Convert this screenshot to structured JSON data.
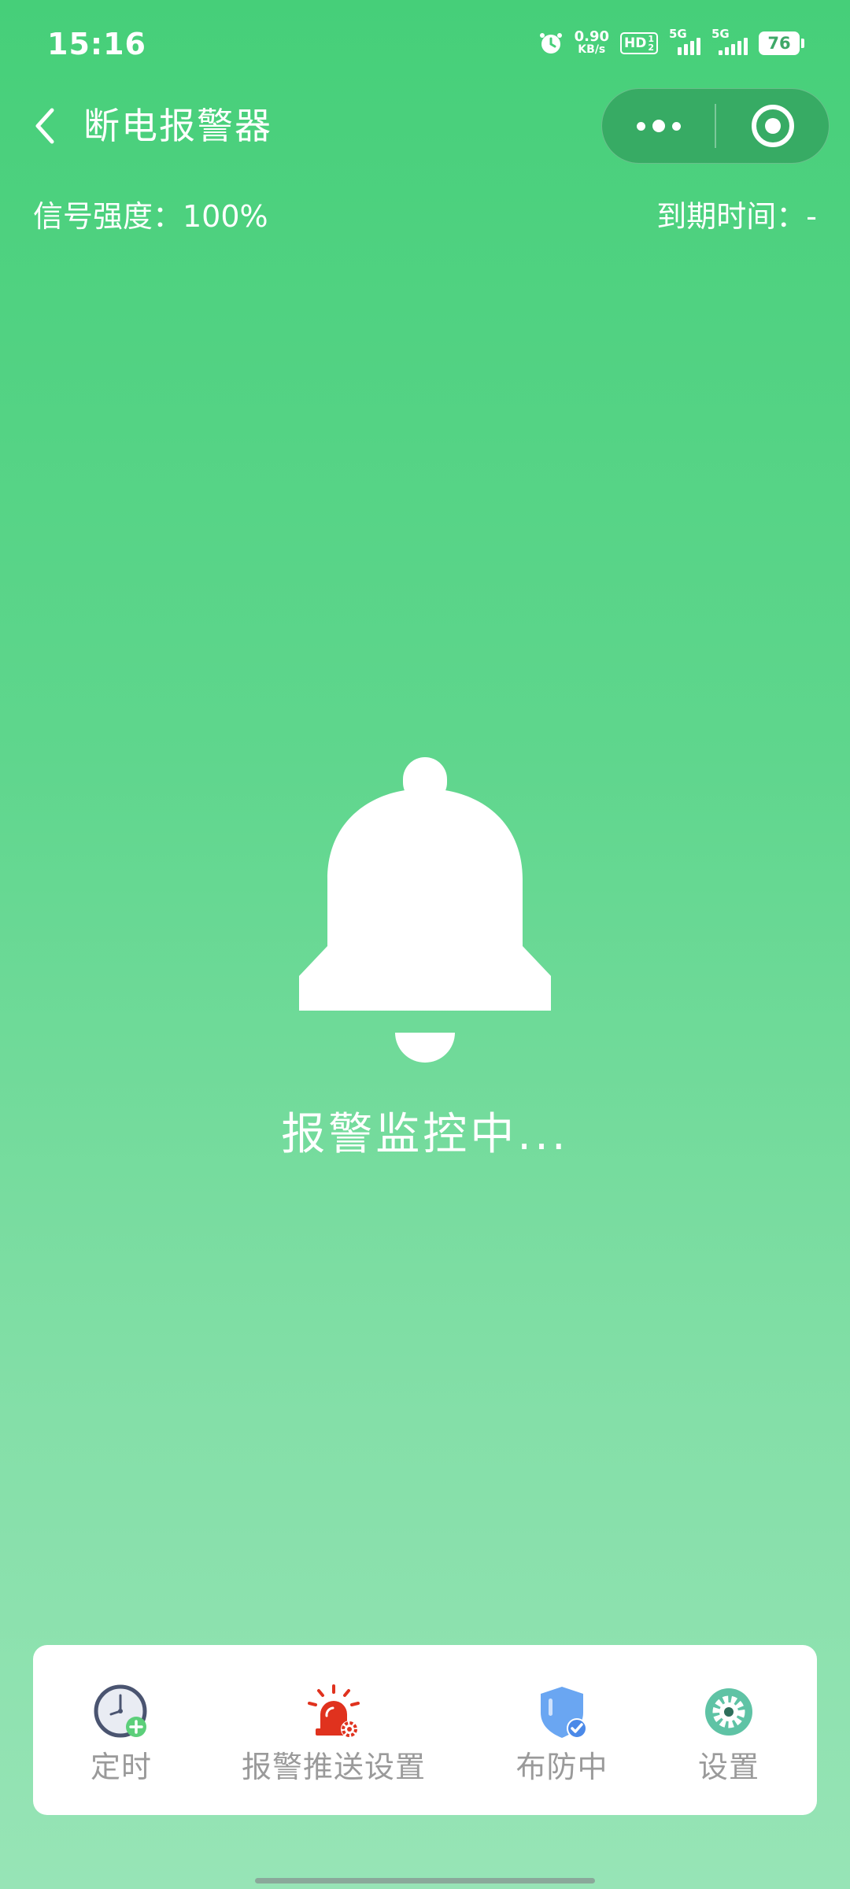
{
  "status_bar": {
    "time": "15:16",
    "net_speed_value": "0.90",
    "net_speed_unit": "KB/s",
    "hd_label": "HD",
    "hd_sub_top": "1",
    "hd_sub_bottom": "2",
    "signal_1_label": "5G",
    "signal_2_label": "5G",
    "battery": "76"
  },
  "nav": {
    "title": "断电报警器",
    "back_icon": "chevron-left-icon",
    "more_icon": "more-dots-icon",
    "close_icon": "target-circle-icon"
  },
  "info": {
    "signal_strength": "信号强度：100%",
    "expire_time": "到期时间：-"
  },
  "main": {
    "bell_icon": "bell-icon",
    "status_text": "报警监控中..."
  },
  "bottom_menu": [
    {
      "label": "定时",
      "icon": "clock-add-icon"
    },
    {
      "label": "报警推送设置",
      "icon": "siren-gear-icon"
    },
    {
      "label": "布防中",
      "icon": "shield-check-icon"
    },
    {
      "label": "设置",
      "icon": "gear-icon"
    }
  ],
  "colors": {
    "gradient_top": "#46cf79",
    "gradient_bottom": "#97e4b6",
    "menu_label": "#9a9a9a",
    "siren_red": "#e0321e",
    "shield_blue": "#6aa6f2",
    "gear_teal": "#5fc3a5"
  }
}
